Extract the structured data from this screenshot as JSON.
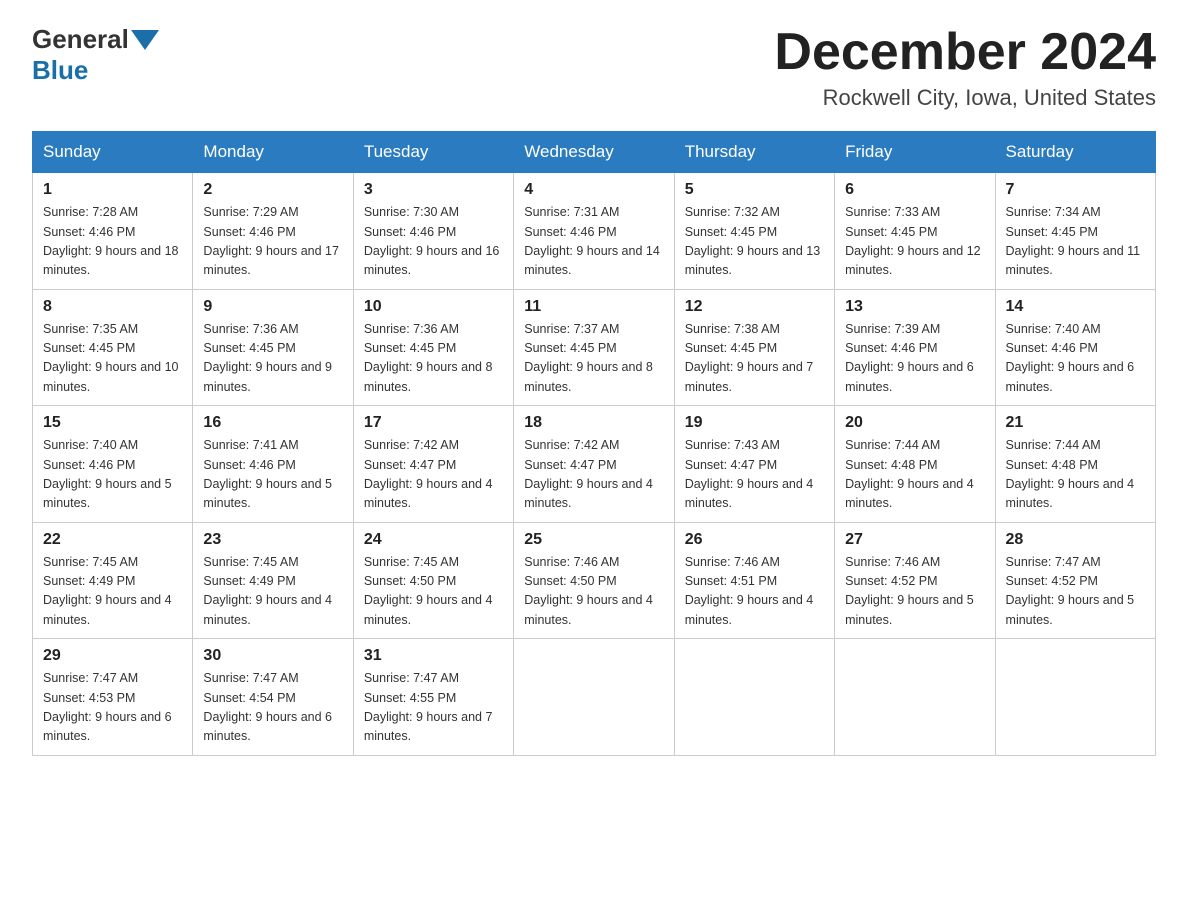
{
  "logo": {
    "general": "General",
    "blue": "Blue"
  },
  "title": "December 2024",
  "location": "Rockwell City, Iowa, United States",
  "days": [
    "Sunday",
    "Monday",
    "Tuesday",
    "Wednesday",
    "Thursday",
    "Friday",
    "Saturday"
  ],
  "weeks": [
    [
      {
        "date": "1",
        "sunrise": "7:28 AM",
        "sunset": "4:46 PM",
        "daylight": "9 hours and 18 minutes."
      },
      {
        "date": "2",
        "sunrise": "7:29 AM",
        "sunset": "4:46 PM",
        "daylight": "9 hours and 17 minutes."
      },
      {
        "date": "3",
        "sunrise": "7:30 AM",
        "sunset": "4:46 PM",
        "daylight": "9 hours and 16 minutes."
      },
      {
        "date": "4",
        "sunrise": "7:31 AM",
        "sunset": "4:46 PM",
        "daylight": "9 hours and 14 minutes."
      },
      {
        "date": "5",
        "sunrise": "7:32 AM",
        "sunset": "4:45 PM",
        "daylight": "9 hours and 13 minutes."
      },
      {
        "date": "6",
        "sunrise": "7:33 AM",
        "sunset": "4:45 PM",
        "daylight": "9 hours and 12 minutes."
      },
      {
        "date": "7",
        "sunrise": "7:34 AM",
        "sunset": "4:45 PM",
        "daylight": "9 hours and 11 minutes."
      }
    ],
    [
      {
        "date": "8",
        "sunrise": "7:35 AM",
        "sunset": "4:45 PM",
        "daylight": "9 hours and 10 minutes."
      },
      {
        "date": "9",
        "sunrise": "7:36 AM",
        "sunset": "4:45 PM",
        "daylight": "9 hours and 9 minutes."
      },
      {
        "date": "10",
        "sunrise": "7:36 AM",
        "sunset": "4:45 PM",
        "daylight": "9 hours and 8 minutes."
      },
      {
        "date": "11",
        "sunrise": "7:37 AM",
        "sunset": "4:45 PM",
        "daylight": "9 hours and 8 minutes."
      },
      {
        "date": "12",
        "sunrise": "7:38 AM",
        "sunset": "4:45 PM",
        "daylight": "9 hours and 7 minutes."
      },
      {
        "date": "13",
        "sunrise": "7:39 AM",
        "sunset": "4:46 PM",
        "daylight": "9 hours and 6 minutes."
      },
      {
        "date": "14",
        "sunrise": "7:40 AM",
        "sunset": "4:46 PM",
        "daylight": "9 hours and 6 minutes."
      }
    ],
    [
      {
        "date": "15",
        "sunrise": "7:40 AM",
        "sunset": "4:46 PM",
        "daylight": "9 hours and 5 minutes."
      },
      {
        "date": "16",
        "sunrise": "7:41 AM",
        "sunset": "4:46 PM",
        "daylight": "9 hours and 5 minutes."
      },
      {
        "date": "17",
        "sunrise": "7:42 AM",
        "sunset": "4:47 PM",
        "daylight": "9 hours and 4 minutes."
      },
      {
        "date": "18",
        "sunrise": "7:42 AM",
        "sunset": "4:47 PM",
        "daylight": "9 hours and 4 minutes."
      },
      {
        "date": "19",
        "sunrise": "7:43 AM",
        "sunset": "4:47 PM",
        "daylight": "9 hours and 4 minutes."
      },
      {
        "date": "20",
        "sunrise": "7:44 AM",
        "sunset": "4:48 PM",
        "daylight": "9 hours and 4 minutes."
      },
      {
        "date": "21",
        "sunrise": "7:44 AM",
        "sunset": "4:48 PM",
        "daylight": "9 hours and 4 minutes."
      }
    ],
    [
      {
        "date": "22",
        "sunrise": "7:45 AM",
        "sunset": "4:49 PM",
        "daylight": "9 hours and 4 minutes."
      },
      {
        "date": "23",
        "sunrise": "7:45 AM",
        "sunset": "4:49 PM",
        "daylight": "9 hours and 4 minutes."
      },
      {
        "date": "24",
        "sunrise": "7:45 AM",
        "sunset": "4:50 PM",
        "daylight": "9 hours and 4 minutes."
      },
      {
        "date": "25",
        "sunrise": "7:46 AM",
        "sunset": "4:50 PM",
        "daylight": "9 hours and 4 minutes."
      },
      {
        "date": "26",
        "sunrise": "7:46 AM",
        "sunset": "4:51 PM",
        "daylight": "9 hours and 4 minutes."
      },
      {
        "date": "27",
        "sunrise": "7:46 AM",
        "sunset": "4:52 PM",
        "daylight": "9 hours and 5 minutes."
      },
      {
        "date": "28",
        "sunrise": "7:47 AM",
        "sunset": "4:52 PM",
        "daylight": "9 hours and 5 minutes."
      }
    ],
    [
      {
        "date": "29",
        "sunrise": "7:47 AM",
        "sunset": "4:53 PM",
        "daylight": "9 hours and 6 minutes."
      },
      {
        "date": "30",
        "sunrise": "7:47 AM",
        "sunset": "4:54 PM",
        "daylight": "9 hours and 6 minutes."
      },
      {
        "date": "31",
        "sunrise": "7:47 AM",
        "sunset": "4:55 PM",
        "daylight": "9 hours and 7 minutes."
      },
      null,
      null,
      null,
      null
    ]
  ]
}
